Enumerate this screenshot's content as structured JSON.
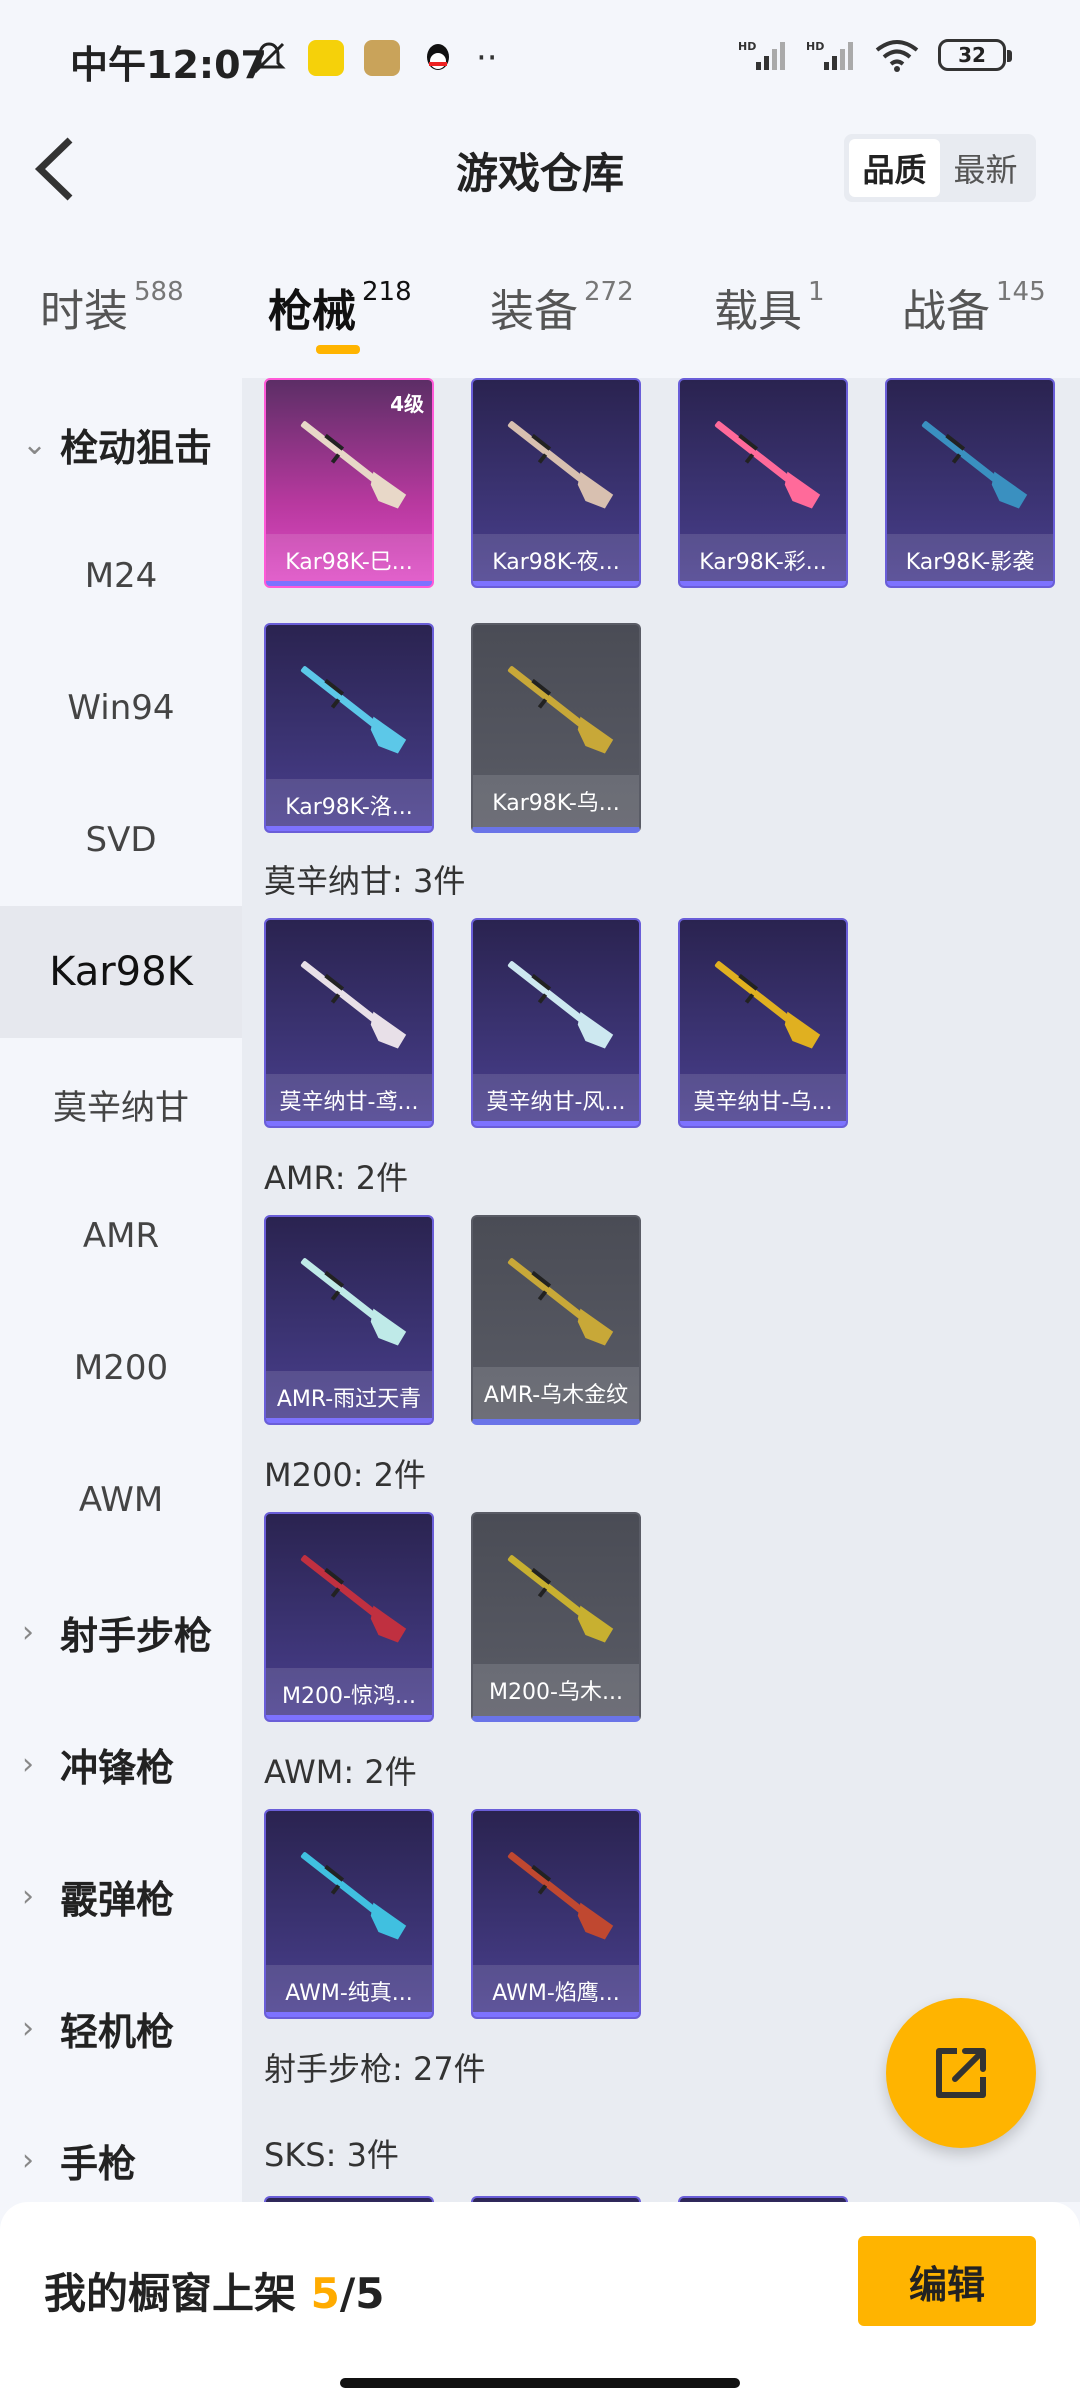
{
  "status_bar": {
    "time": "中午12:07",
    "battery": "32",
    "colors": {
      "app1": "#f5d10a",
      "app2": "#c9a35a",
      "app3": "#1a1a1a"
    }
  },
  "header": {
    "title": "游戏仓库",
    "sort_options": [
      "品质",
      "最新"
    ],
    "selected_sort": "品质"
  },
  "tabs": [
    {
      "label": "时装",
      "count": "588"
    },
    {
      "label": "枪械",
      "count": "218",
      "active": true
    },
    {
      "label": "装备",
      "count": "272"
    },
    {
      "label": "载具",
      "count": "1"
    },
    {
      "label": "战备",
      "count": "145"
    }
  ],
  "sidebar": {
    "items": [
      {
        "label": "栓动狙击",
        "type": "group",
        "expanded": true
      },
      {
        "label": "M24"
      },
      {
        "label": "Win94"
      },
      {
        "label": "SVD"
      },
      {
        "label": "Kar98K",
        "active": true
      },
      {
        "label": "莫辛纳甘"
      },
      {
        "label": "AMR"
      },
      {
        "label": "M200"
      },
      {
        "label": "AWM"
      },
      {
        "label": "射手步枪",
        "type": "group"
      },
      {
        "label": "冲锋枪",
        "type": "group"
      },
      {
        "label": "霰弹枪",
        "type": "group"
      },
      {
        "label": "轻机枪",
        "type": "group"
      },
      {
        "label": "手枪",
        "type": "group"
      }
    ]
  },
  "content": {
    "kar98k_items": [
      {
        "name": "Kar98K-巳...",
        "level": "4级",
        "style": "pink",
        "accent": "#e8d8c8"
      },
      {
        "name": "Kar98K-夜...",
        "style": "purple",
        "accent": "#d8c0b0"
      },
      {
        "name": "Kar98K-彩...",
        "style": "purple",
        "accent": "#ff6a9a"
      },
      {
        "name": "Kar98K-影袭",
        "style": "purple",
        "accent": "#3a90c0"
      },
      {
        "name": "Kar98K-洛...",
        "style": "purple",
        "accent": "#5cc8e8"
      },
      {
        "name": "Kar98K-乌...",
        "style": "gray",
        "accent": "#c8a838"
      }
    ],
    "mosin_label": "莫辛纳甘: 3件",
    "mosin_items": [
      {
        "name": "莫辛纳甘-鸢...",
        "style": "purple",
        "accent": "#e8e0e8"
      },
      {
        "name": "莫辛纳甘-风...",
        "style": "purple",
        "accent": "#cde8f0"
      },
      {
        "name": "莫辛纳甘-乌...",
        "style": "purple",
        "accent": "#e0b020"
      }
    ],
    "amr_label": "AMR: 2件",
    "amr_items": [
      {
        "name": "AMR-雨过天青",
        "style": "purple",
        "accent": "#bfeae8"
      },
      {
        "name": "AMR-乌木金纹",
        "style": "gray",
        "accent": "#c8a838"
      }
    ],
    "m200_label": "M200: 2件",
    "m200_items": [
      {
        "name": "M200-惊鸿...",
        "style": "purple",
        "accent": "#c03040"
      },
      {
        "name": "M200-乌木...",
        "style": "gray",
        "accent": "#c8b030"
      }
    ],
    "awm_label": "AWM: 2件",
    "awm_items": [
      {
        "name": "AWM-纯真...",
        "style": "purple",
        "accent": "#40c0e0"
      },
      {
        "name": "AWM-焰鹰...",
        "style": "purple",
        "accent": "#c04830"
      }
    ],
    "marksman_label": "射手步枪: 27件",
    "sks_label": "SKS: 3件"
  },
  "bottom_bar": {
    "label": "我的橱窗上架",
    "count_current": "5",
    "count_total": "/5",
    "edit_label": "编辑"
  },
  "colors": {
    "accent": "#ffb400",
    "card_purple": "#3b3372",
    "card_pink": "#e04cc7",
    "card_gray": "#5a5c66"
  }
}
